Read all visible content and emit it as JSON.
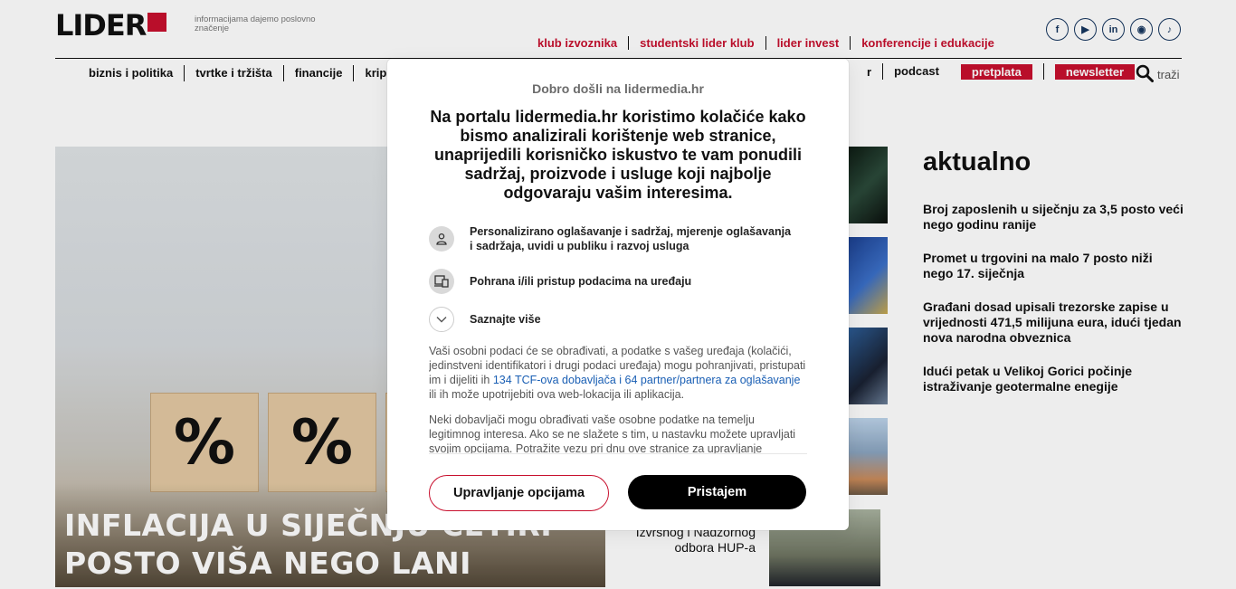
{
  "site": {
    "logo_text": "LIDER",
    "tagline": "informacijama dajemo poslovno značenje",
    "brand_color": "#c8102e"
  },
  "top_links": [
    "klub izvoznika",
    "studentski lider klub",
    "lider invest",
    "konferencije i edukacije"
  ],
  "social_icons": [
    "facebook-icon",
    "youtube-icon",
    "linkedin-icon",
    "instagram-icon",
    "tiktok-icon"
  ],
  "nav": {
    "items": [
      "biznis i politika",
      "tvrtke i tržišta",
      "financije",
      "krip"
    ],
    "partial_item": "r",
    "podcast": "podcast",
    "subscribe": "pretplata",
    "newsletter": "newsletter",
    "search_label": "traži"
  },
  "hero": {
    "title_line1": "INFLACIJA U SIJEČNJU ČETIRI",
    "title_line2": "POSTO VIŠA NEGO LANI",
    "block_symbol": "%"
  },
  "middle": {
    "caption": "Izvršnog i Nadzornog odbora HUP-a"
  },
  "aktualno": {
    "heading": "aktualno",
    "items": [
      "Broj zaposlenih u siječnju za 3,5 posto veći nego godinu ranije",
      "Promet u trgovini na malo 7 posto niži nego 17. siječnja",
      "Građani dosad upisali trezorske zapise u vrijednosti 471,5 milijuna eura, idući tjedan nova narodna obveznica",
      "Idući petak u Velikoj Gorici počinje istraživanje geotermalne enegije"
    ]
  },
  "consent": {
    "welcome": "Dobro došli na lidermedia.hr",
    "headline": "Na portalu lidermedia.hr koristimo kolačiće kako bismo analizirali korištenje web stranice, unaprijedili korisničko iskustvo te vam ponudili sadržaj, proizvode i usluge koji najbolje odgovaraju vašim interesima.",
    "purposes": [
      {
        "icon": "person-icon",
        "text": "Personalizirano oglašavanje i sadržaj, mjerenje oglašavanja i sadržaja, uvidi u publiku i razvoj usluga"
      },
      {
        "icon": "devices-icon",
        "text": "Pohrana i/ili pristup podacima na uređaju"
      },
      {
        "icon": "chevron-down-icon",
        "text": "Saznajte više"
      }
    ],
    "body_p1_before": "Vaši osobni podaci će se obrađivati, a podatke s vašeg uređaja (kolačići, jedinstveni identifikatori i drugi podaci uređaja) mogu pohranjivati, pristupati im i dijeliti ih ",
    "body_p1_link": "134 TCF-ova dobavljača i 64 partner/partnera za oglašavanje",
    "body_p1_after": " ili ih može upotrijebiti ova web-lokacija ili aplikacija.",
    "body_p2": "Neki dobavljači mogu obrađivati vaše osobne podatke na temelju legitimnog interesa. Ako se ne slažete s tim, u nastavku možete upravljati svojim opcijama. Potražite vezu pri dnu ove stranice za upravljanje",
    "manage_button": "Upravljanje opcijama",
    "accept_button": "Pristajem"
  }
}
